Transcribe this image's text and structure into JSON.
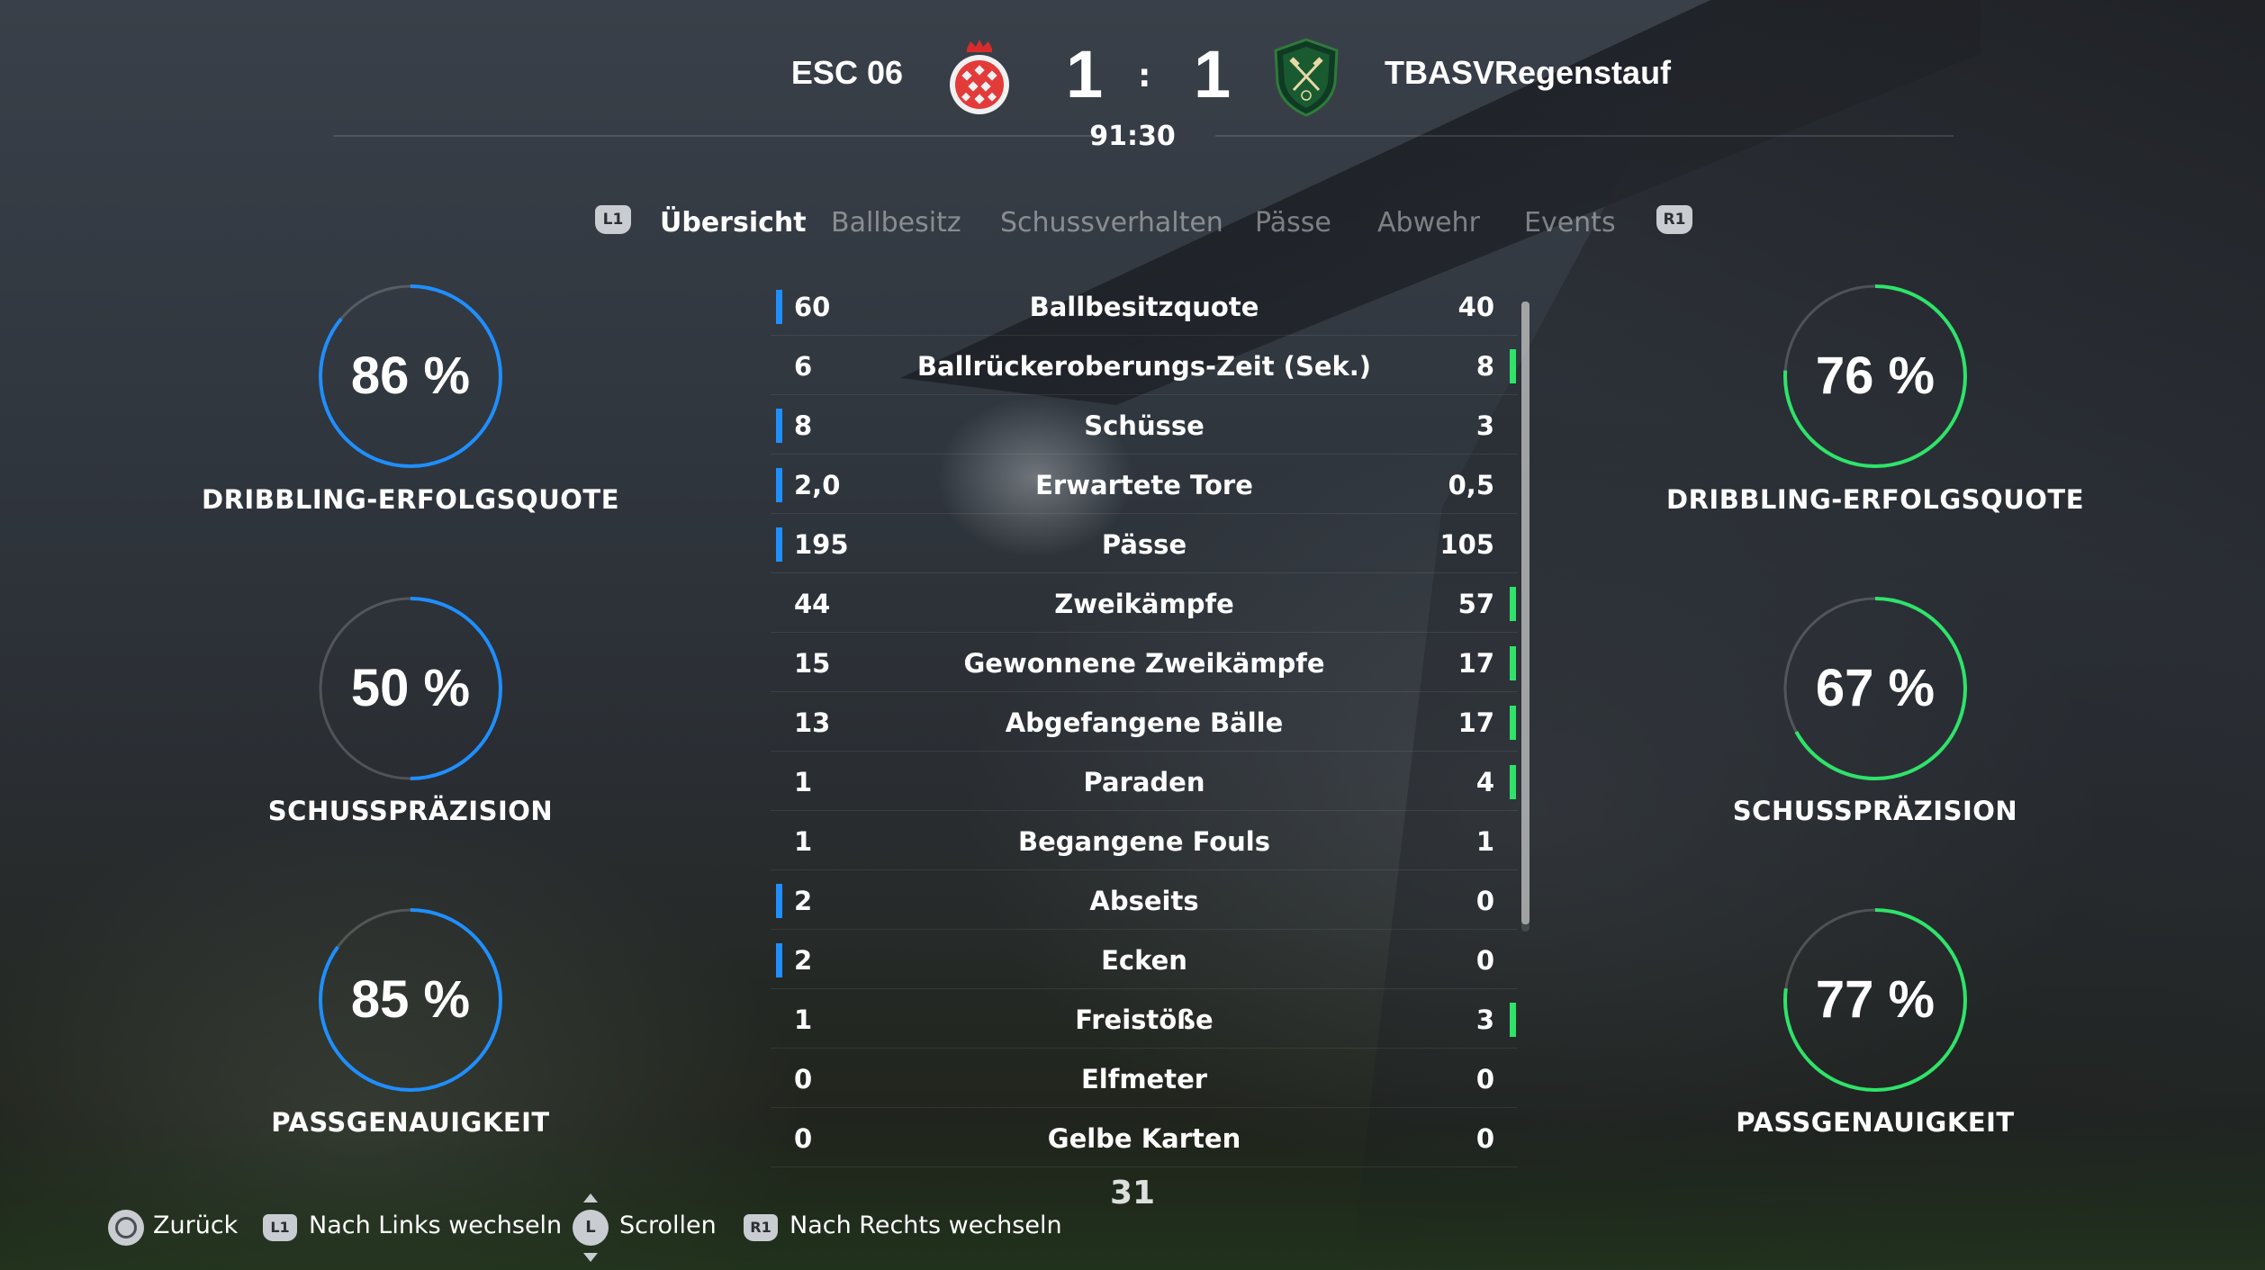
{
  "header": {
    "home_team": "ESC 06",
    "away_team": "TBASVRegenstauf",
    "home_score": "1",
    "away_score": "1",
    "separator": ":",
    "clock": "91:30"
  },
  "tabs": {
    "left_button": "L1",
    "right_button": "R1",
    "items": [
      "Übersicht",
      "Ballbesitz",
      "Schussverhalten",
      "Pässe",
      "Abwehr",
      "Events"
    ],
    "active": "Übersicht"
  },
  "home_stats": [
    {
      "value": "86 %",
      "fraction": 0.86,
      "label": "DRIBBLING-ERFOLGSQUOTE"
    },
    {
      "value": "50 %",
      "fraction": 0.5,
      "label": "SCHUSSPRÄZISION"
    },
    {
      "value": "85 %",
      "fraction": 0.85,
      "label": "PASSGENAUIGKEIT"
    }
  ],
  "away_stats": [
    {
      "value": "76 %",
      "fraction": 0.76,
      "label": "DRIBBLING-ERFOLGSQUOTE"
    },
    {
      "value": "67 %",
      "fraction": 0.67,
      "label": "SCHUSSPRÄZISION"
    },
    {
      "value": "77 %",
      "fraction": 0.77,
      "label": "PASSGENAUIGKEIT"
    }
  ],
  "colors": {
    "home": "#1f8fff",
    "away": "#2fe36a",
    "track": "rgba(255,255,255,0.18)"
  },
  "stats": [
    {
      "label": "Ballbesitzquote",
      "home": "60",
      "away": "40",
      "leader": "home"
    },
    {
      "label": "Ballrückeroberungs-Zeit (Sek.)",
      "home": "6",
      "away": "8",
      "leader": "away"
    },
    {
      "label": "Schüsse",
      "home": "8",
      "away": "3",
      "leader": "home"
    },
    {
      "label": "Erwartete Tore",
      "home": "2,0",
      "away": "0,5",
      "leader": "home"
    },
    {
      "label": "Pässe",
      "home": "195",
      "away": "105",
      "leader": "home"
    },
    {
      "label": "Zweikämpfe",
      "home": "44",
      "away": "57",
      "leader": "away"
    },
    {
      "label": "Gewonnene Zweikämpfe",
      "home": "15",
      "away": "17",
      "leader": "away"
    },
    {
      "label": "Abgefangene Bälle",
      "home": "13",
      "away": "17",
      "leader": "away"
    },
    {
      "label": "Paraden",
      "home": "1",
      "away": "4",
      "leader": "away"
    },
    {
      "label": "Begangene Fouls",
      "home": "1",
      "away": "1",
      "leader": "none"
    },
    {
      "label": "Abseits",
      "home": "2",
      "away": "0",
      "leader": "home"
    },
    {
      "label": "Ecken",
      "home": "2",
      "away": "0",
      "leader": "home"
    },
    {
      "label": "Freistöße",
      "home": "1",
      "away": "3",
      "leader": "away"
    },
    {
      "label": "Elfmeter",
      "home": "0",
      "away": "0",
      "leader": "none"
    },
    {
      "label": "Gelbe Karten",
      "home": "0",
      "away": "0",
      "leader": "none"
    }
  ],
  "page_counter": "31",
  "footer": {
    "back": "Zurück",
    "left_badge": "L1",
    "left": "Nach Links wechseln",
    "stick_badge": "L",
    "scroll": "Scrollen",
    "right_badge": "R1",
    "right": "Nach Rechts wechseln"
  }
}
